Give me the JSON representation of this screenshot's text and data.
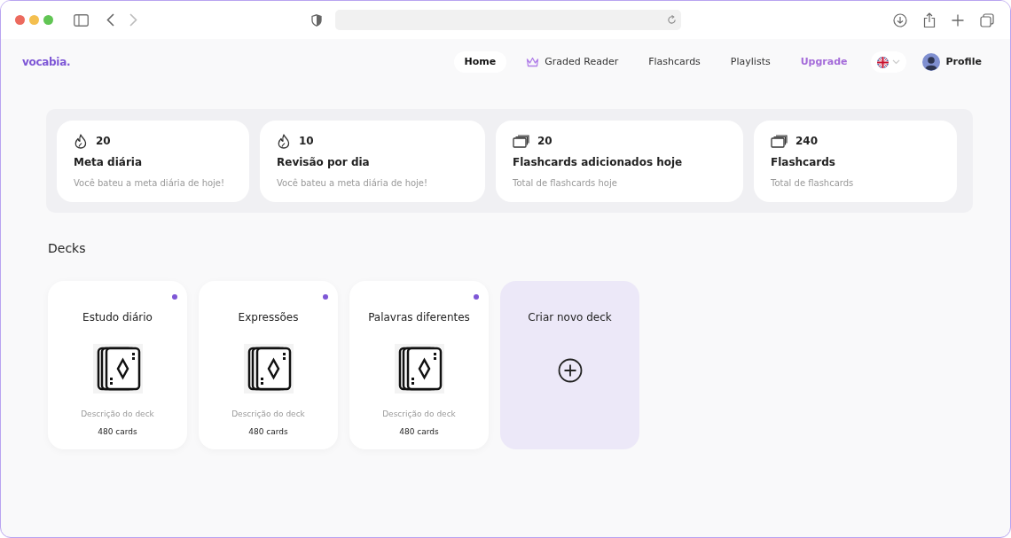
{
  "logo": "vocabia.",
  "nav": [
    {
      "label": "Home",
      "selected": true,
      "kind": "plain"
    },
    {
      "label": "Graded Reader",
      "selected": false,
      "kind": "crown"
    },
    {
      "label": "Flashcards",
      "selected": false,
      "kind": "plain"
    },
    {
      "label": "Playlists",
      "selected": false,
      "kind": "plain"
    },
    {
      "label": "Upgrade",
      "selected": false,
      "kind": "upgrade"
    }
  ],
  "profile": {
    "label": "Profile"
  },
  "stats": [
    {
      "kind": "flame",
      "value": "20",
      "title": "Meta diária",
      "subtitle": "Você bateu a meta diária de hoje!"
    },
    {
      "kind": "flame",
      "value": "10",
      "title": "Revisão por dia",
      "subtitle": "Você bateu a meta diária de hoje!"
    },
    {
      "kind": "cards",
      "value": "20",
      "title": "Flashcards adicionados hoje",
      "subtitle": "Total de flashcards hoje"
    },
    {
      "kind": "cards",
      "value": "240",
      "title": "Flashcards",
      "subtitle": "Total de flashcards"
    }
  ],
  "decks_heading": "Decks",
  "decks": [
    {
      "title": "Estudo diário",
      "description": "Descrição do deck",
      "count": "480 cards",
      "marked": true
    },
    {
      "title": "Expressões",
      "description": "Descrição do deck",
      "count": "480 cards",
      "marked": true
    },
    {
      "title": "Palavras diferentes",
      "description": "Descrição do deck",
      "count": "480 cards",
      "marked": true
    }
  ],
  "new_deck": {
    "label": "Criar novo deck"
  }
}
